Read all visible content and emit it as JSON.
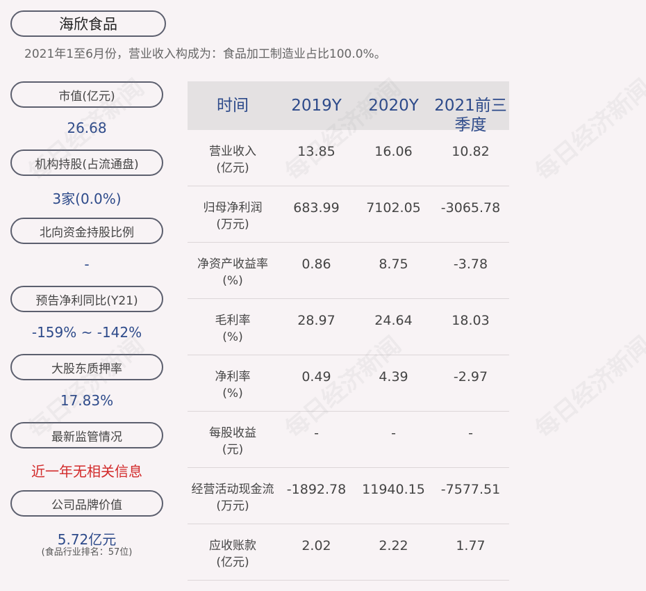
{
  "header": {
    "company": "海欣食品",
    "subtitle": "2021年1至6月份，营业收入构成为：食品加工制造业占比100.0%。"
  },
  "metrics": [
    {
      "label": "市值(亿元)",
      "value": "26.68"
    },
    {
      "label": "机构持股(占流通盘)",
      "value": "3家(0.0%)"
    },
    {
      "label": "北向资金持股比例",
      "value": "-"
    },
    {
      "label": "预告净利同比(Y21)",
      "value": "-159% ~ -142%"
    },
    {
      "label": "大股东质押率",
      "value": "17.83%"
    },
    {
      "label": "最新监管情况",
      "value": "近一年无相关信息"
    },
    {
      "label": "公司品牌价值",
      "value": "5.72亿元",
      "note": "(食品行业排名：57位)"
    }
  ],
  "table": {
    "headers": [
      "时间",
      "2019Y",
      "2020Y",
      "2021前三季度"
    ],
    "rows": [
      {
        "label": "营业收入\n(亿元)",
        "values": [
          "13.85",
          "16.06",
          "10.82"
        ]
      },
      {
        "label": "归母净利润\n(万元)",
        "values": [
          "683.99",
          "7102.05",
          "-3065.78"
        ]
      },
      {
        "label": "净资产收益率\n(%)",
        "values": [
          "0.86",
          "8.75",
          "-3.78"
        ]
      },
      {
        "label": "毛利率\n(%)",
        "values": [
          "28.97",
          "24.64",
          "18.03"
        ]
      },
      {
        "label": "净利率\n(%)",
        "values": [
          "0.49",
          "4.39",
          "-2.97"
        ]
      },
      {
        "label": "每股收益\n(元)",
        "values": [
          "-",
          "-",
          "-"
        ]
      },
      {
        "label": "经营活动现金流\n(万元)",
        "values": [
          "-1892.78",
          "11940.15",
          "-7577.51"
        ]
      },
      {
        "label": "应收账款\n(亿元)",
        "values": [
          "2.02",
          "2.22",
          "1.77"
        ]
      }
    ]
  },
  "watermark": "每日经济新闻",
  "colors": {
    "accent": "#2d4a8a",
    "alert": "#d22a2a",
    "background": "#f8f3f5"
  }
}
